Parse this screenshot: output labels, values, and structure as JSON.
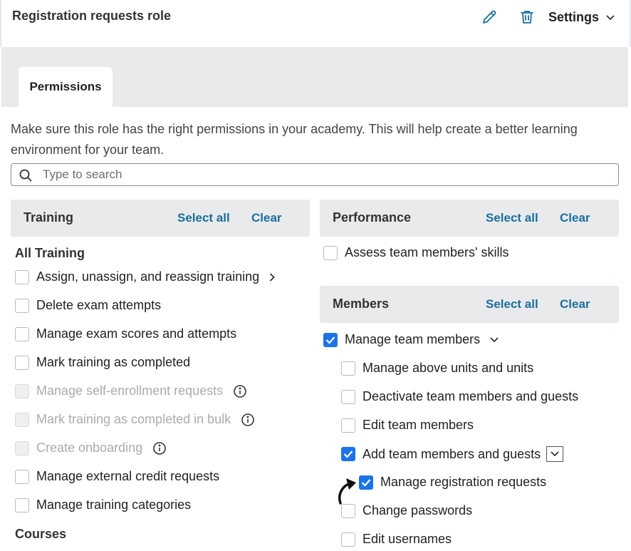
{
  "header": {
    "role_title": "Registration requests role",
    "settings_label": "Settings"
  },
  "tabs": [
    {
      "label": "Permissions",
      "active": true
    }
  ],
  "description": "Make sure this role has the right permissions in your academy. This will help create a better learning environment for your team.",
  "search": {
    "placeholder": "Type to search",
    "value": ""
  },
  "colors": {
    "accent_link": "#1a6f9c",
    "checkbox_checked": "#1b73e8",
    "section_bg": "#e9eaeb"
  },
  "training": {
    "title": "Training",
    "select_all": "Select all",
    "clear": "Clear",
    "group_all": "All Training",
    "items": [
      {
        "label": "Assign, unassign, and reassign training",
        "checked": false,
        "disabled": false,
        "icon": "chevron-right-icon"
      },
      {
        "label": "Delete exam attempts",
        "checked": false,
        "disabled": false
      },
      {
        "label": "Manage exam scores and attempts",
        "checked": false,
        "disabled": false
      },
      {
        "label": "Mark training as completed",
        "checked": false,
        "disabled": false
      },
      {
        "label": "Manage self-enrollment requests",
        "checked": false,
        "disabled": true,
        "icon": "info-icon"
      },
      {
        "label": "Mark training as completed in bulk",
        "checked": false,
        "disabled": true,
        "icon": "info-icon"
      },
      {
        "label": "Create onboarding",
        "checked": false,
        "disabled": true,
        "icon": "info-icon"
      },
      {
        "label": "Manage external credit requests",
        "checked": false,
        "disabled": false
      },
      {
        "label": "Manage training categories",
        "checked": false,
        "disabled": false
      }
    ],
    "group_courses": "Courses"
  },
  "performance": {
    "title": "Performance",
    "select_all": "Select all",
    "clear": "Clear",
    "items": [
      {
        "label": "Assess team members' skills",
        "checked": false
      }
    ]
  },
  "members": {
    "title": "Members",
    "select_all": "Select all",
    "clear": "Clear",
    "parent": {
      "label": "Manage team members",
      "checked": true,
      "icon": "chevron-down-icon"
    },
    "items": [
      {
        "label": "Manage above units and units",
        "checked": false
      },
      {
        "label": "Deactivate team members and guests",
        "checked": false
      },
      {
        "label": "Edit team members",
        "checked": false
      },
      {
        "label": "Add team members and guests",
        "checked": true,
        "icon": "chevron-down-icon"
      },
      {
        "label": "Manage registration requests",
        "checked": true
      },
      {
        "label": "Change passwords",
        "checked": false
      },
      {
        "label": "Edit usernames",
        "checked": false
      }
    ]
  }
}
